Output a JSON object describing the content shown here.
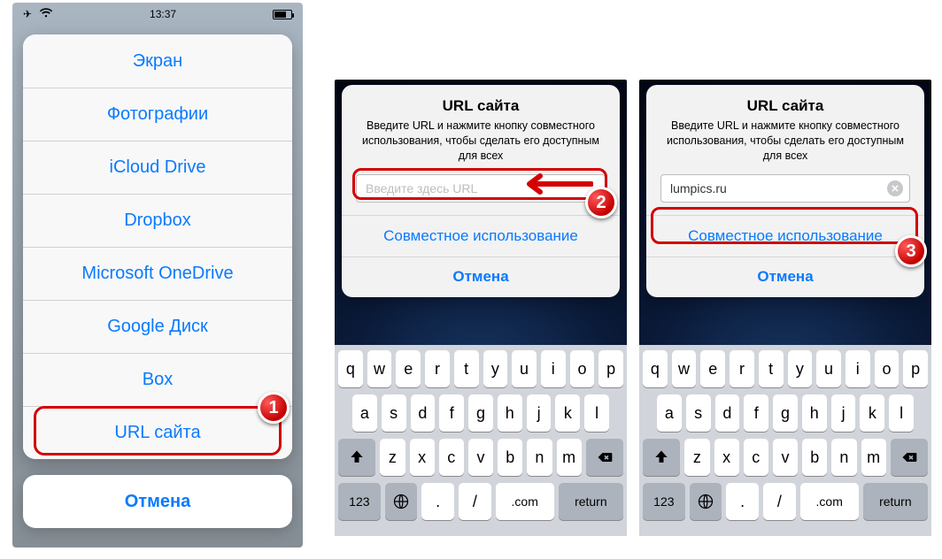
{
  "statusbar": {
    "time": "13:37"
  },
  "sheet": {
    "items": [
      "Экран",
      "Фотографии",
      "iCloud Drive",
      "Dropbox",
      "Microsoft OneDrive",
      "Google Диск",
      "Box",
      "URL сайта"
    ],
    "cancel": "Отмена"
  },
  "alert": {
    "title": "URL сайта",
    "message": "Введите URL и нажмите кнопку совместного использования, чтобы сделать его доступным для всех",
    "placeholder": "Введите здесь URL",
    "value_p3": "lumpics.ru",
    "share": "Совместное использование",
    "cancel": "Отмена"
  },
  "keyboard": {
    "row1": [
      "q",
      "w",
      "e",
      "r",
      "t",
      "y",
      "u",
      "i",
      "o",
      "p"
    ],
    "row2": [
      "a",
      "s",
      "d",
      "f",
      "g",
      "h",
      "j",
      "k",
      "l"
    ],
    "shift": "⇧",
    "row3": [
      "z",
      "x",
      "c",
      "v",
      "b",
      "n",
      "m"
    ],
    "backspace": "⌫",
    "numkey": "123",
    "globe": "🌐",
    "dot": ".",
    "slash": "/",
    "com": ".com",
    "ret": "return"
  },
  "badges": {
    "b1": "1",
    "b2": "2",
    "b3": "3"
  }
}
